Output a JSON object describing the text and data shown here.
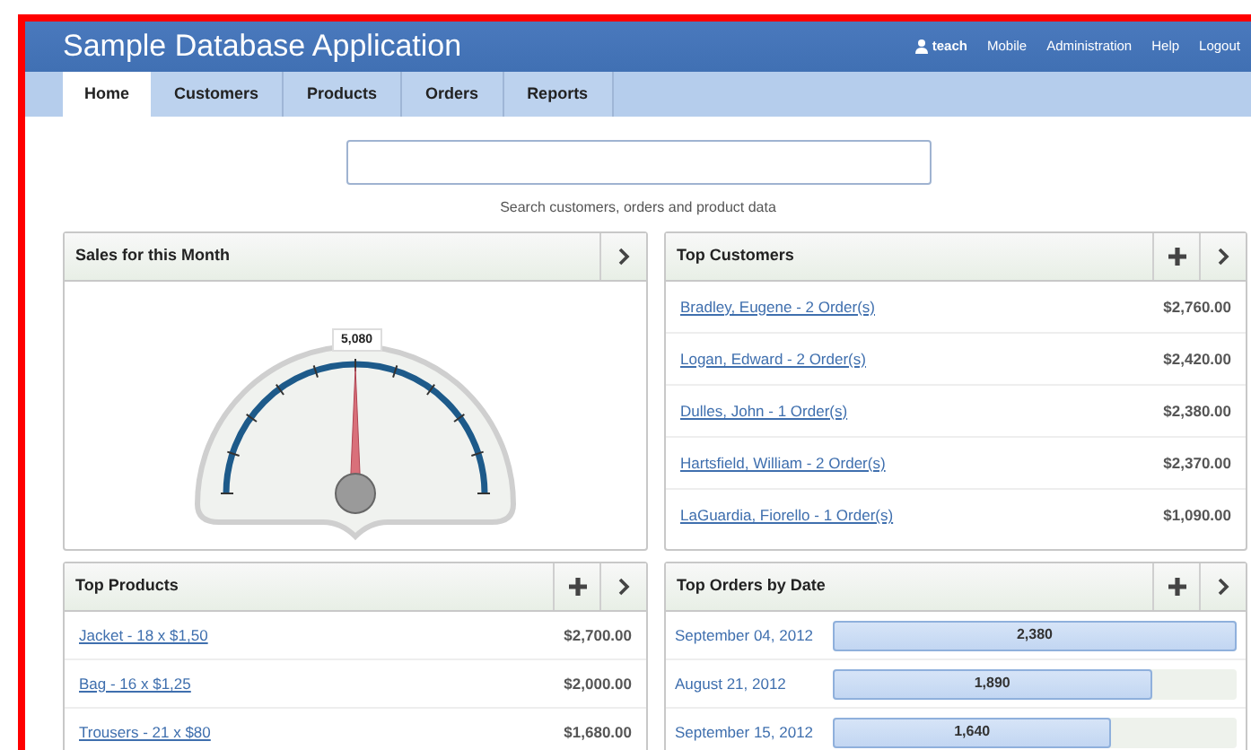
{
  "header": {
    "title": "Sample Database Application",
    "user": "teach",
    "links": [
      "Mobile",
      "Administration",
      "Help",
      "Logout"
    ]
  },
  "tabs": [
    {
      "label": "Home",
      "selected": true
    },
    {
      "label": "Customers",
      "selected": false
    },
    {
      "label": "Products",
      "selected": false
    },
    {
      "label": "Orders",
      "selected": false
    },
    {
      "label": "Reports",
      "selected": false
    }
  ],
  "search": {
    "hint": "Search customers, orders and product data"
  },
  "sales_panel": {
    "title": "Sales for this Month",
    "gauge": {
      "reading": "5,080"
    }
  },
  "top_customers": {
    "title": "Top Customers",
    "rows": [
      {
        "name": "Bradley, Eugene - 2 Order(s)",
        "amount": "$2,760.00"
      },
      {
        "name": "Logan, Edward - 2 Order(s)",
        "amount": "$2,420.00"
      },
      {
        "name": "Dulles, John - 1 Order(s)",
        "amount": "$2,380.00"
      },
      {
        "name": "Hartsfield, William - 2 Order(s)",
        "amount": "$2,370.00"
      },
      {
        "name": "LaGuardia, Fiorello - 1 Order(s)",
        "amount": "$1,090.00"
      }
    ]
  },
  "top_products": {
    "title": "Top Products",
    "rows": [
      {
        "name": "Jacket - 18 x $1,50",
        "amount": "$2,700.00"
      },
      {
        "name": "Bag - 16 x $1,25",
        "amount": "$2,000.00"
      },
      {
        "name": "Trousers - 21 x $80",
        "amount": "$1,680.00"
      }
    ]
  },
  "top_orders": {
    "title": "Top Orders by Date",
    "rows": [
      {
        "date": "September 04, 2012",
        "total": "2,380",
        "level": 1
      },
      {
        "date": "August 21, 2012",
        "total": "1,890",
        "level": 0.79
      },
      {
        "date": "September 15, 2012",
        "total": "1,640",
        "level": 0.69
      }
    ]
  }
}
